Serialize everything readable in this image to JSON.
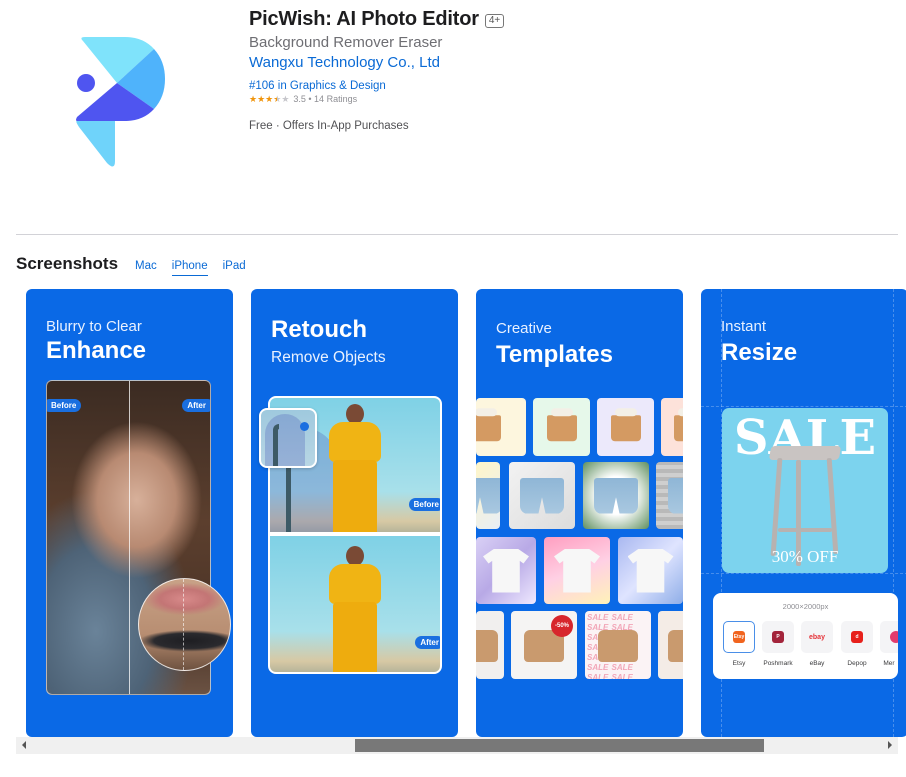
{
  "app": {
    "title": "PicWish: AI Photo Editor",
    "age_rating": "4+",
    "subtitle": "Background Remover Eraser",
    "developer": "Wangxu Technology Co., Ltd",
    "rank": "#106 in Graphics & Design",
    "rating_value": 3.5,
    "rating_stars_filled": 3.5,
    "rating_stars_total": 5,
    "rating_text": "3.5 • 14 Ratings",
    "price": "Free · Offers In-App Purchases",
    "icon": "picwish-logo-icon",
    "colors": {
      "logo_light": "#7fe3fb",
      "logo_mid": "#4fb3fb",
      "logo_dark": "#4f55f0",
      "logo_tail": "#6fd3fa",
      "link": "#0a6ad5",
      "star": "#f0940b"
    }
  },
  "screenshots": {
    "title": "Screenshots",
    "tabs": [
      {
        "label": "Mac",
        "active": false
      },
      {
        "label": "iPhone",
        "active": true
      },
      {
        "label": "iPad",
        "active": false
      }
    ],
    "card_color": "#0a69e6",
    "cards": [
      {
        "line1": "Blurry to Clear",
        "line2": "Enhance",
        "labels": [
          "Before",
          "After"
        ]
      },
      {
        "line1": "Retouch",
        "line2": "Remove Objects",
        "labels": [
          "Before",
          "After"
        ]
      },
      {
        "line1": "Creative",
        "line2": "Templates",
        "badge": "-50%",
        "sale_pattern": "SALE SALE SALE SALE SALE SALE SALE SALE SALE SALE SALE SALE SALE SALE SALE SALE SALE SALE"
      },
      {
        "line1": "Instant",
        "line2": "Resize",
        "sale_word": "SALE",
        "sale_off": "30% OFF",
        "size_label": "2000×2000px",
        "platforms": [
          {
            "name": "Etsy",
            "logo": "Etsy",
            "color": "#f1641e",
            "selected": true
          },
          {
            "name": "Poshmark",
            "logo": "P",
            "color": "#a3243b",
            "selected": false
          },
          {
            "name": "eBay",
            "logo": "ebay",
            "color": "#ffffff",
            "selected": false
          },
          {
            "name": "Depop",
            "logo": "d",
            "color": "#e7201b",
            "selected": false
          },
          {
            "name": "Mer",
            "logo": "",
            "color": "#e23b6d",
            "selected": false
          }
        ]
      }
    ]
  },
  "scrollbar": {
    "position_fraction": 0.38,
    "visible_fraction": 0.48
  }
}
